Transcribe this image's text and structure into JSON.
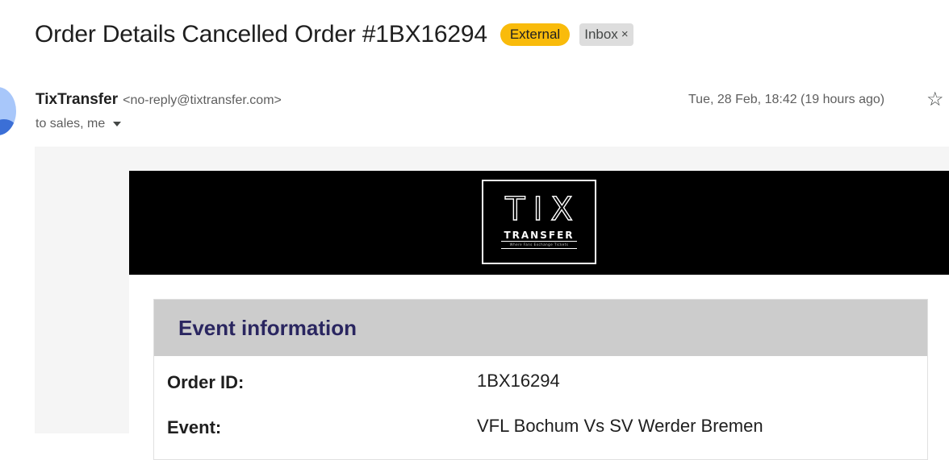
{
  "email": {
    "subject": "Order Details Cancelled Order #1BX16294",
    "labels": {
      "external": "External",
      "inbox": "Inbox",
      "inbox_remove": "×"
    },
    "sender": {
      "name": "TixTransfer",
      "email": "<no-reply@tixtransfer.com>"
    },
    "recipients": "to sales, me",
    "date": "Tue, 28 Feb, 18:42 (19 hours ago)",
    "star_icon": "☆"
  },
  "logo": {
    "line1": "TIX",
    "line2": "TRANSFER",
    "tagline": "Where Fans Exchange Tickets"
  },
  "event_info": {
    "title": "Event information",
    "rows": [
      {
        "label": "Order ID:",
        "value": "1BX16294"
      },
      {
        "label": "Event:",
        "value": "VFL Bochum Vs SV Werder Bremen"
      }
    ]
  },
  "colors": {
    "external_badge": "#f9bb0b",
    "inbox_badge": "#dddddd",
    "header_band": "#000000",
    "section_header_bg": "#cccccc",
    "section_title": "#2a2660"
  }
}
